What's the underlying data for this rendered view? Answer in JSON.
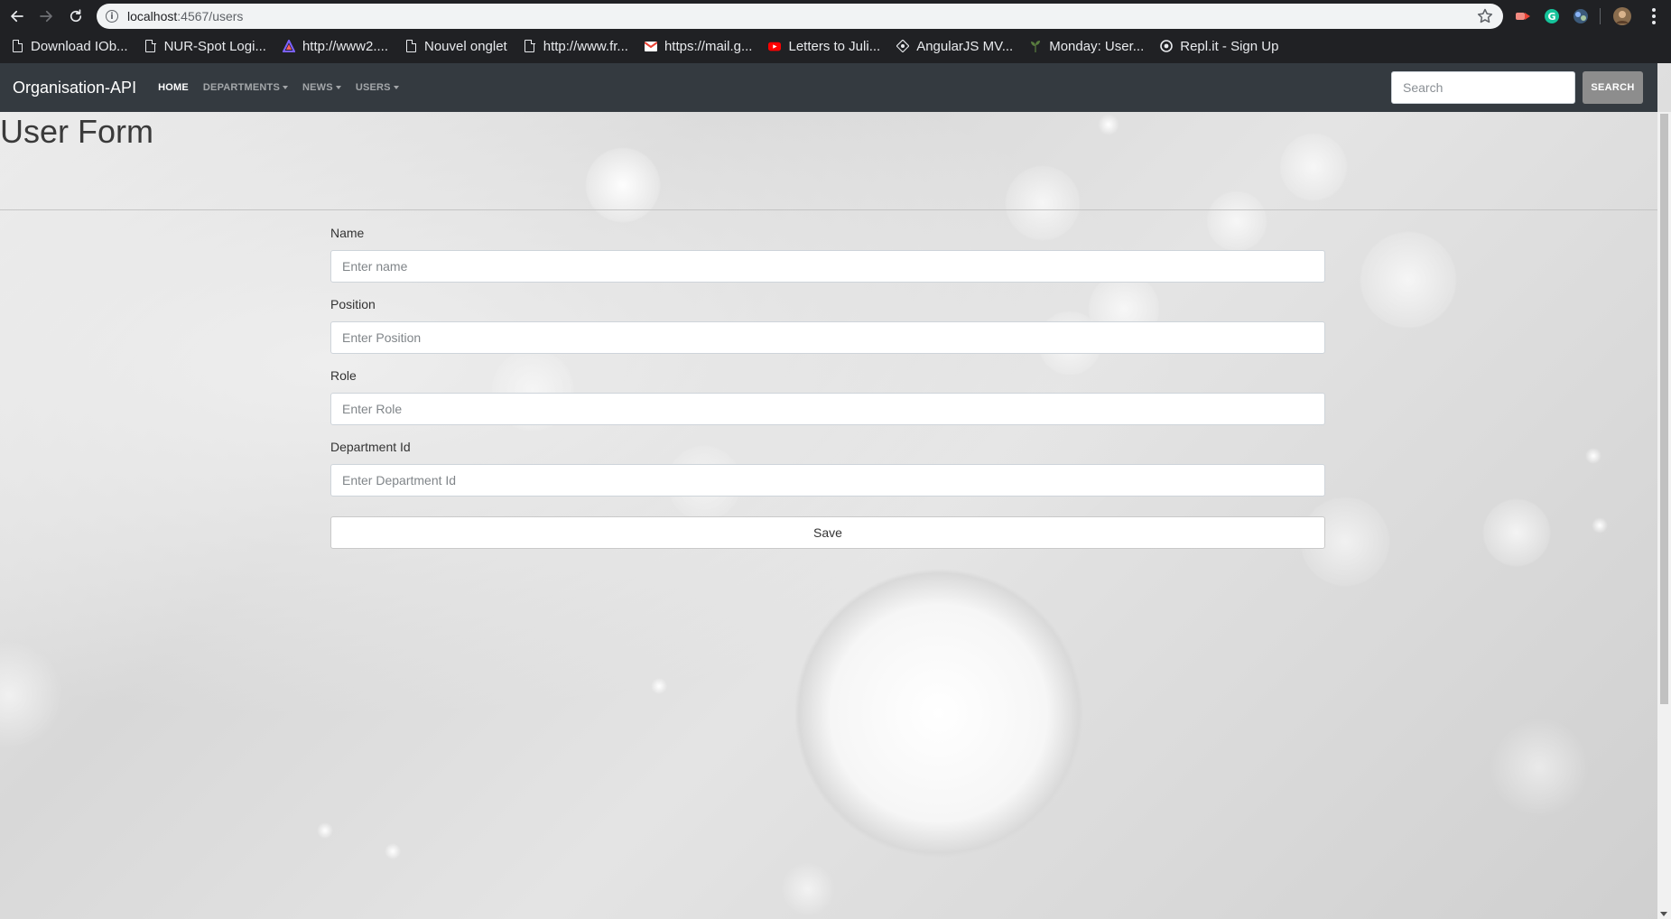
{
  "browser": {
    "url_host": "localhost",
    "url_path": ":4567/users",
    "bookmarks": [
      {
        "label": "Download IOb...",
        "icon": "document-icon"
      },
      {
        "label": "NUR-Spot Logi...",
        "icon": "document-icon"
      },
      {
        "label": "http://www2....",
        "icon": "triangle-logo-icon"
      },
      {
        "label": "Nouvel onglet",
        "icon": "document-icon"
      },
      {
        "label": "http://www.fr...",
        "icon": "document-icon"
      },
      {
        "label": "https://mail.g...",
        "icon": "gmail-icon"
      },
      {
        "label": "Letters to Juli...",
        "icon": "youtube-icon"
      },
      {
        "label": "AngularJS MV...",
        "icon": "angular-icon"
      },
      {
        "label": "Monday: User...",
        "icon": "plant-icon"
      },
      {
        "label": "Repl.it - Sign Up",
        "icon": "replit-icon"
      }
    ]
  },
  "navbar": {
    "brand": "Organisation-API",
    "links": [
      {
        "label": "HOME",
        "active": true
      },
      {
        "label": "DEPARTMENTS",
        "dropdown": true
      },
      {
        "label": "NEWS",
        "dropdown": true
      },
      {
        "label": "USERS",
        "dropdown": true
      }
    ],
    "search_placeholder": "Search",
    "search_button": "SEARCH"
  },
  "page": {
    "title": "User Form"
  },
  "form": {
    "fields": [
      {
        "label": "Name",
        "placeholder": "Enter name",
        "value": ""
      },
      {
        "label": "Position",
        "placeholder": "Enter Position",
        "value": ""
      },
      {
        "label": "Role",
        "placeholder": "Enter Role",
        "value": ""
      },
      {
        "label": "Department Id",
        "placeholder": "Enter Department Id",
        "value": ""
      }
    ],
    "submit_label": "Save"
  },
  "colors": {
    "browser_chrome": "#202124",
    "navbar_bg": "#343a40",
    "search_button_bg": "#8d8d8d"
  }
}
